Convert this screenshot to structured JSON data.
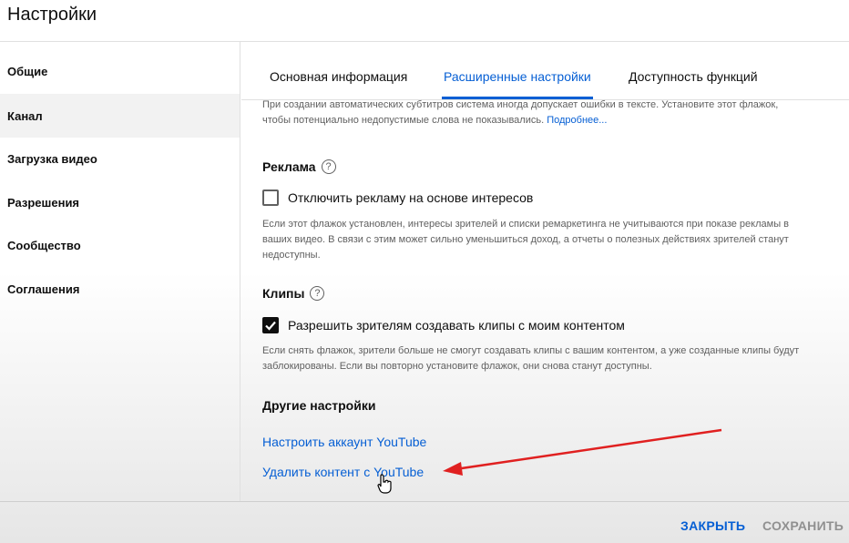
{
  "header": {
    "title": "Настройки"
  },
  "sidebar": {
    "items": [
      {
        "label": "Общие"
      },
      {
        "label": "Канал"
      },
      {
        "label": "Загрузка видео"
      },
      {
        "label": "Разрешения"
      },
      {
        "label": "Сообщество"
      },
      {
        "label": "Соглашения"
      }
    ],
    "active": "Канал"
  },
  "tabs": [
    {
      "label": "Основная информация"
    },
    {
      "label": "Расширенные настройки"
    },
    {
      "label": "Доступность функций"
    }
  ],
  "active_tab": "Расширенные настройки",
  "subtitles_help": {
    "text": "При создании автоматических субтитров система иногда допускает ошибки в тексте. Установите этот флажок, чтобы потенциально недопустимые слова не показывались.",
    "link": "Подробнее..."
  },
  "ads": {
    "title": "Реклама",
    "checkbox_label": "Отключить рекламу на основе интересов",
    "checked": false,
    "help": "Если этот флажок установлен, интересы зрителей и списки ремаркетинга не учитываются при показе рекламы в ваших видео. В связи с этим может сильно уменьшиться доход, а отчеты о полезных действиях зрителей станут недоступны."
  },
  "clips": {
    "title": "Клипы",
    "checkbox_label": "Разрешить зрителям создавать клипы с моим контентом",
    "checked": true,
    "help": "Если снять флажок, зрители больше не смогут создавать клипы с вашим контентом, а уже созданные клипы будут заблокированы. Если вы повторно установите флажок, они снова станут доступны."
  },
  "other": {
    "title": "Другие настройки",
    "links": [
      {
        "label": "Настроить аккаунт YouTube"
      },
      {
        "label": "Удалить контент с YouTube"
      }
    ]
  },
  "footer": {
    "close": "ЗАКРЫТЬ",
    "save": "СОХРАНИТЬ"
  },
  "icons": {
    "help": "question-circle-icon",
    "check": "checkmark-icon",
    "cursor": "hand-pointer-icon",
    "annotation": "red-arrow"
  },
  "colors": {
    "link": "#065fd4",
    "arrow": "#e02020"
  }
}
